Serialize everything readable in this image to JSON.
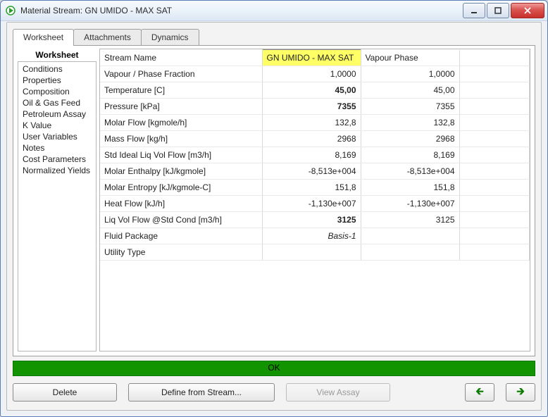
{
  "window": {
    "title": "Material Stream: GN UMIDO - MAX SAT"
  },
  "tabs": [
    {
      "label": "Worksheet",
      "active": true
    },
    {
      "label": "Attachments",
      "active": false
    },
    {
      "label": "Dynamics",
      "active": false
    }
  ],
  "sidebar": {
    "heading": "Worksheet",
    "items": [
      "Conditions",
      "Properties",
      "Composition",
      "Oil & Gas Feed",
      "Petroleum Assay",
      "K Value",
      "User Variables",
      "Notes",
      "Cost Parameters",
      "Normalized Yields"
    ],
    "selected": "Conditions"
  },
  "grid": {
    "header_row_label": "Stream Name",
    "columns": [
      {
        "header": "GN UMIDO - MAX SAT",
        "kind": "main"
      },
      {
        "header": "Vapour Phase",
        "kind": "phase"
      }
    ],
    "rows": [
      {
        "label": "Vapour / Phase Fraction",
        "values": [
          "1,0000",
          "1,0000"
        ],
        "styles": [
          "",
          ""
        ]
      },
      {
        "label": "Temperature [C]",
        "values": [
          "45,00",
          "45,00"
        ],
        "styles": [
          "blue",
          ""
        ]
      },
      {
        "label": "Pressure [kPa]",
        "values": [
          "7355",
          "7355"
        ],
        "styles": [
          "blue",
          ""
        ]
      },
      {
        "label": "Molar Flow [kgmole/h]",
        "values": [
          "132,8",
          "132,8"
        ],
        "styles": [
          "",
          ""
        ]
      },
      {
        "label": "Mass Flow [kg/h]",
        "values": [
          "2968",
          "2968"
        ],
        "styles": [
          "",
          ""
        ]
      },
      {
        "label": "Std Ideal Liq Vol Flow [m3/h]",
        "values": [
          "8,169",
          "8,169"
        ],
        "styles": [
          "",
          ""
        ]
      },
      {
        "label": "Molar Enthalpy [kJ/kgmole]",
        "values": [
          "-8,513e+004",
          "-8,513e+004"
        ],
        "styles": [
          "",
          ""
        ]
      },
      {
        "label": "Molar Entropy [kJ/kgmole-C]",
        "values": [
          "151,8",
          "151,8"
        ],
        "styles": [
          "",
          ""
        ]
      },
      {
        "label": "Heat Flow [kJ/h]",
        "values": [
          "-1,130e+007",
          "-1,130e+007"
        ],
        "styles": [
          "",
          ""
        ]
      },
      {
        "label": "Liq Vol Flow @Std Cond [m3/h]",
        "values": [
          "3125",
          "3125"
        ],
        "styles": [
          "blue",
          ""
        ]
      },
      {
        "label": "Fluid Package",
        "values": [
          "Basis-1",
          ""
        ],
        "styles": [
          "blue-i",
          ""
        ]
      },
      {
        "label": "Utility Type",
        "values": [
          "",
          ""
        ],
        "styles": [
          "",
          ""
        ]
      }
    ]
  },
  "status_bar": {
    "text": "OK"
  },
  "buttons": {
    "delete": "Delete",
    "define": "Define from Stream...",
    "view_assay": "View Assay",
    "prev_glyph": "🡰",
    "next_glyph": "🡲"
  },
  "colors": {
    "accent_blue": "#0a3bd6",
    "ok_green": "#119400",
    "highlight_yellow": "#ffff66"
  }
}
